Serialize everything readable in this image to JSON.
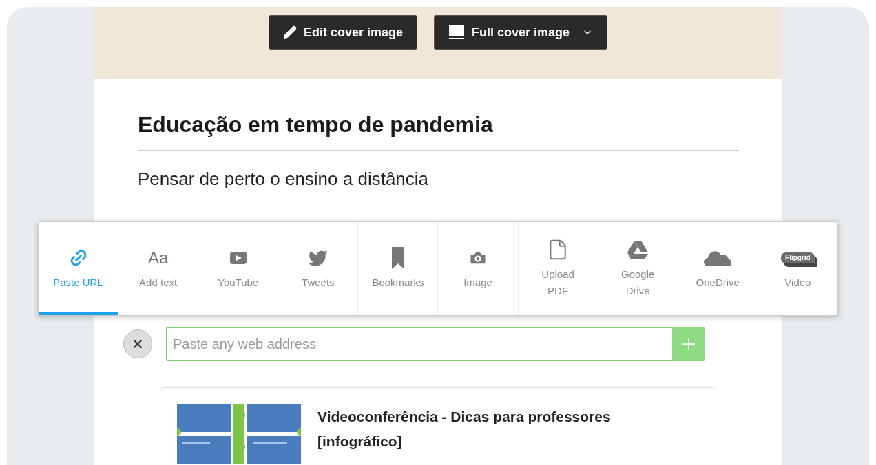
{
  "cover": {
    "buttons": [
      {
        "kind": "edit",
        "label": "Edit cover image"
      },
      {
        "kind": "layout",
        "label": "Full cover image"
      }
    ]
  },
  "title": "Educação em tempo de pandemia",
  "subtitle": "Pensar de perto o ensino a distância",
  "tools": [
    {
      "kind": "link",
      "label": "Paste URL",
      "selected": true
    },
    {
      "kind": "text",
      "label": "Add text",
      "glyph": "Aa",
      "selected": false
    },
    {
      "kind": "youtube",
      "label": "YouTube",
      "selected": false
    },
    {
      "kind": "twitter",
      "label": "Tweets",
      "selected": false
    },
    {
      "kind": "bookmark",
      "label": "Bookmarks",
      "selected": false
    },
    {
      "kind": "camera",
      "label": "Image",
      "selected": false
    },
    {
      "kind": "file",
      "label": "Upload PDF",
      "selected": false
    },
    {
      "kind": "drive",
      "label": "Google Drive",
      "selected": false
    },
    {
      "kind": "cloud",
      "label": "OneDrive",
      "selected": false
    },
    {
      "kind": "flipgrid",
      "label": "Video",
      "logo": "Flipgrid",
      "selected": false
    }
  ],
  "url_field": {
    "placeholder": "Paste any web address"
  },
  "card": {
    "title": "Videoconferência - Dicas para professores [infográfico]"
  }
}
